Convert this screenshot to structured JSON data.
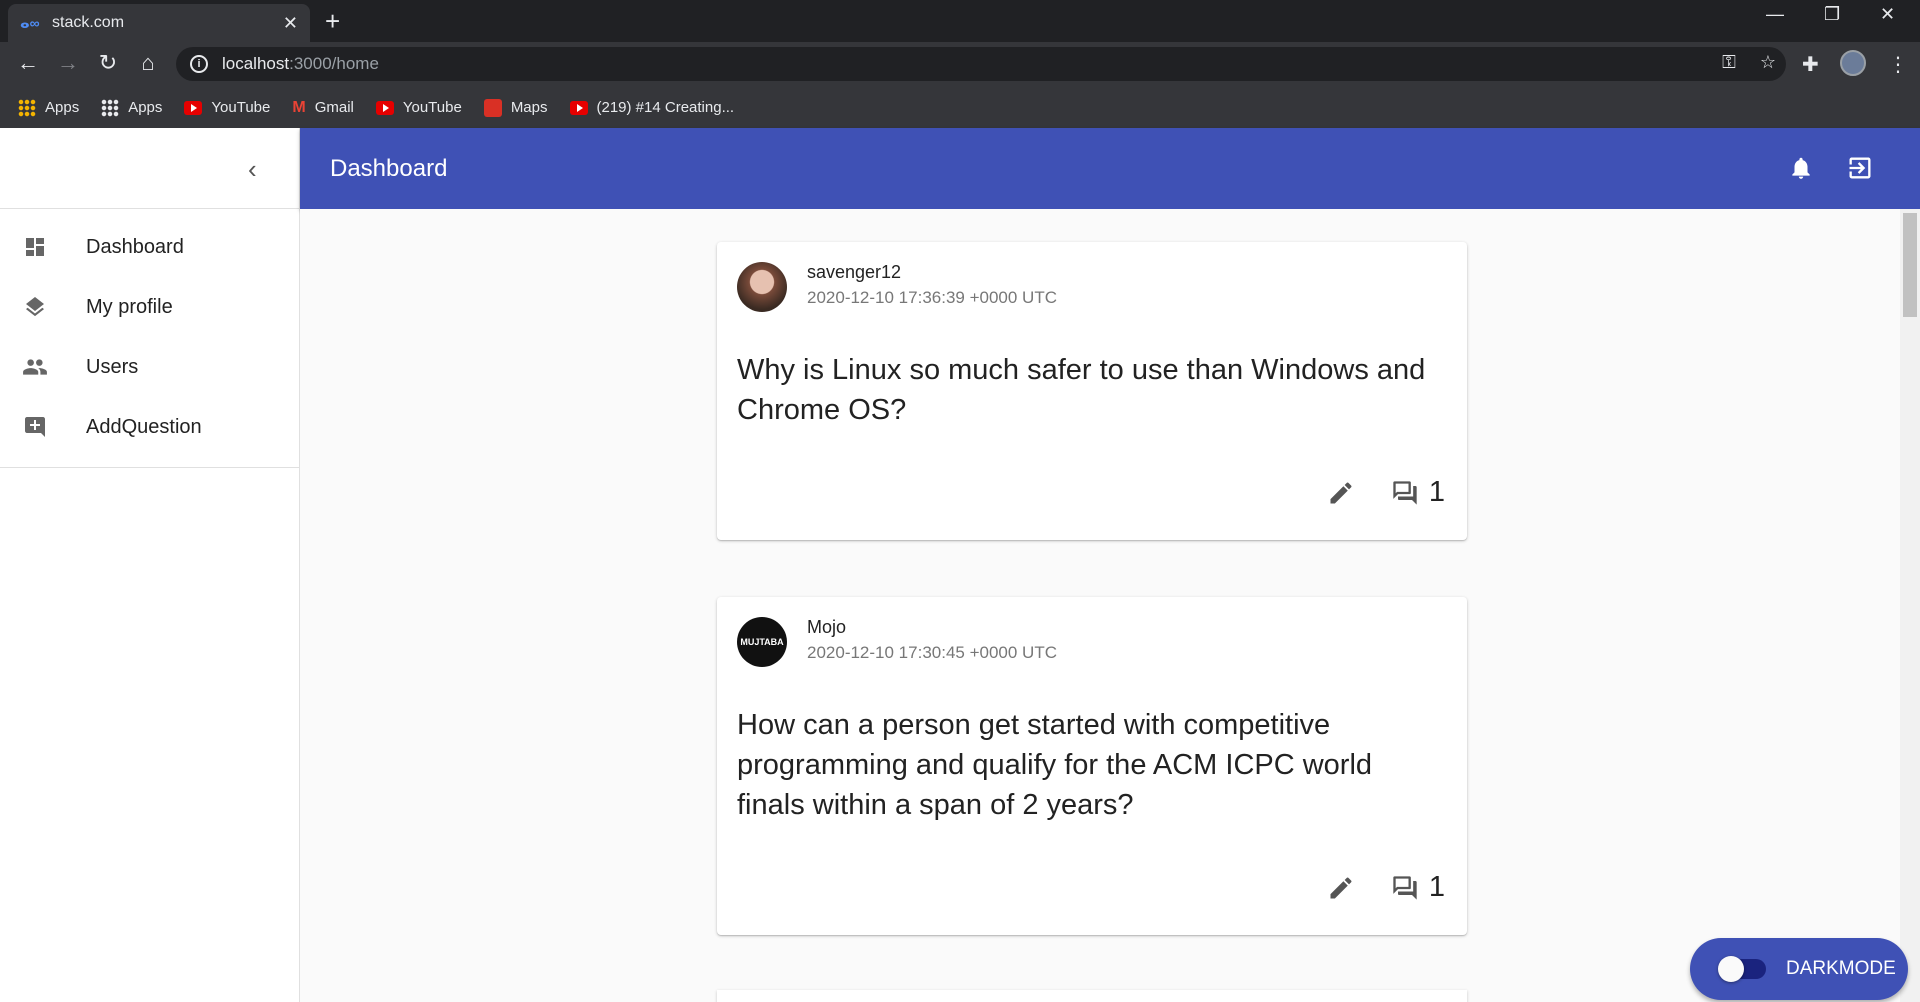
{
  "browser": {
    "tab_title": "stack.com",
    "url_host": "localhost",
    "url_path": ":3000/home",
    "bookmarks": [
      {
        "label": "Apps",
        "icon": "google-apps-icon"
      },
      {
        "label": "Apps",
        "icon": "apps-grid-icon"
      },
      {
        "label": "YouTube",
        "icon": "youtube-icon"
      },
      {
        "label": "Gmail",
        "icon": "gmail-icon"
      },
      {
        "label": "YouTube",
        "icon": "youtube-icon"
      },
      {
        "label": "Maps",
        "icon": "maps-icon"
      },
      {
        "label": "(219) #14 Creating...",
        "icon": "youtube-icon"
      }
    ]
  },
  "sidebar": {
    "items": [
      {
        "label": "Dashboard",
        "icon": "dashboard-icon"
      },
      {
        "label": "My profile",
        "icon": "layers-icon"
      },
      {
        "label": "Users",
        "icon": "people-icon"
      },
      {
        "label": "AddQuestion",
        "icon": "add-comment-icon"
      }
    ]
  },
  "appbar": {
    "title": "Dashboard"
  },
  "posts": [
    {
      "username": "savenger12",
      "date": "2020-12-10 17:36:39 +0000 UTC",
      "question": "Why is Linux so much safer to use than Windows and Chrome OS?",
      "comments": "1"
    },
    {
      "username": "Mojo",
      "avatar_text": "MUJTABA",
      "date": "2020-12-10 17:30:45 +0000 UTC",
      "question": "How can a person get started with competitive programming and qualify for the ACM ICPC world finals within a span of 2 years?",
      "comments": "1"
    }
  ],
  "darkmode": {
    "label": "DARKMODE",
    "enabled": false
  },
  "colors": {
    "primary": "#3f51b5",
    "chrome_dark": "#202124",
    "chrome_mid": "#35363a"
  }
}
